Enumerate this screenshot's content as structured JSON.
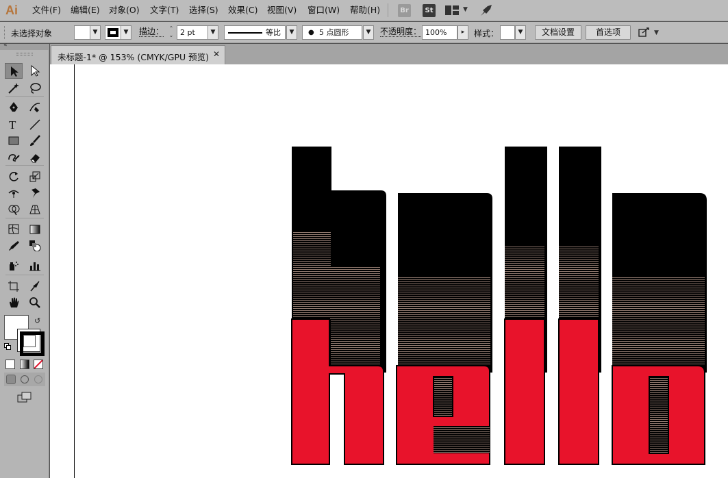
{
  "app": {
    "logo": "Ai"
  },
  "menu": [
    "文件(F)",
    "编辑(E)",
    "对象(O)",
    "文字(T)",
    "选择(S)",
    "效果(C)",
    "视图(V)",
    "窗口(W)",
    "帮助(H)"
  ],
  "menu_icons": {
    "bridge": "Br",
    "stock": "St"
  },
  "control": {
    "selection_status": "未选择对象",
    "stroke_label": "描边：",
    "stroke_weight": "2 pt",
    "stroke_profile": "等比",
    "brush": "5 点圆形",
    "opacity_label": "不透明度：",
    "opacity_value": "100%",
    "style_label": "样式：",
    "doc_setup_btn": "文档设置",
    "prefs_btn": "首选项"
  },
  "document": {
    "tab_label": "未标题-1* @ 153% (CMYK/GPU 预览)",
    "close_glyph": "✕"
  },
  "artwork": {
    "text": "hello",
    "front_color": "#e8132b",
    "back_color": "#000000",
    "blend_line_color": "#c9a99a"
  },
  "colors": {
    "ui_bg": "#bcbcbc",
    "panel_bg": "#b5b5b5",
    "logo_color": "#b6753b"
  },
  "tools": [
    "selection-tool",
    "direct-selection-tool",
    "magic-wand-tool",
    "lasso-tool",
    "pen-tool",
    "curvature-tool",
    "type-tool",
    "line-segment-tool",
    "rectangle-tool",
    "paintbrush-tool",
    "shaper-tool",
    "eraser-tool",
    "rotate-tool",
    "scale-tool",
    "width-tool",
    "puppet-warp-tool",
    "shape-builder-tool",
    "perspective-grid-tool",
    "mesh-tool",
    "gradient-tool",
    "eyedropper-tool",
    "blend-tool",
    "symbol-sprayer-tool",
    "column-graph-tool",
    "artboard-tool",
    "slice-tool",
    "hand-tool",
    "zoom-tool"
  ]
}
